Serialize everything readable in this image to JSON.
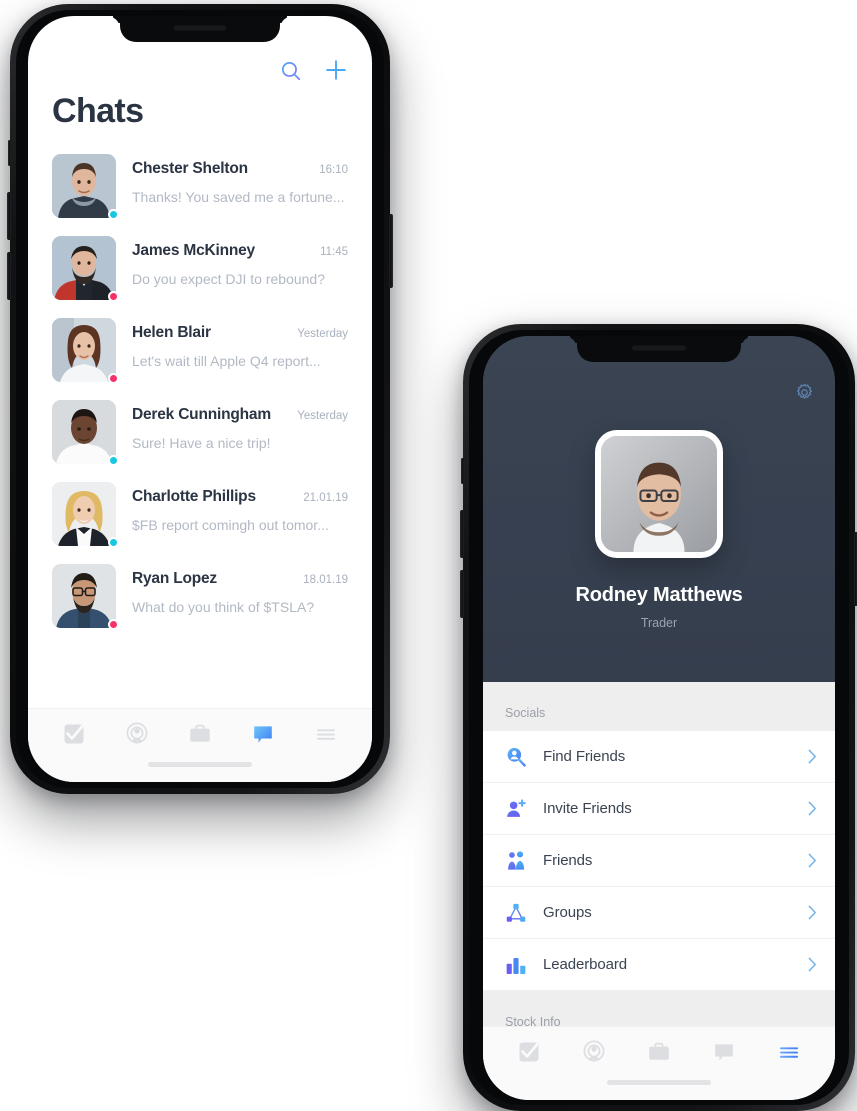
{
  "left_phone": {
    "screen_name": "chats-screen",
    "topbar": {
      "search_icon": "search-icon",
      "add_icon": "plus-icon"
    },
    "title": "Chats",
    "chats": [
      {
        "name": "Chester Shelton",
        "time": "16:10",
        "preview": "Thanks! You saved me a fortune...",
        "status": "online",
        "avatar": "avatar-chester"
      },
      {
        "name": "James McKinney",
        "time": "11:45",
        "preview": "Do you expect DJI to rebound?",
        "status": "offline",
        "avatar": "avatar-james"
      },
      {
        "name": "Helen Blair",
        "time": "Yesterday",
        "preview": "Let's wait till Apple Q4 report...",
        "status": "offline",
        "avatar": "avatar-helen"
      },
      {
        "name": "Derek Cunningham",
        "time": "Yesterday",
        "preview": "Sure! Have a nice trip!",
        "status": "online",
        "avatar": "avatar-derek"
      },
      {
        "name": "Charlotte Phillips",
        "time": "21.01.19",
        "preview": "$FB report comingh out tomor...",
        "status": "online",
        "avatar": "avatar-charlotte"
      },
      {
        "name": "Ryan Lopez",
        "time": "18.01.19",
        "preview": "What do you think of $TSLA?",
        "status": "offline",
        "avatar": "avatar-ryan"
      }
    ],
    "tabbar": {
      "active": "chat",
      "items": [
        {
          "key": "tasks",
          "icon": "checkbox-check-icon"
        },
        {
          "key": "radar",
          "icon": "radar-person-icon"
        },
        {
          "key": "portfolio",
          "icon": "briefcase-icon"
        },
        {
          "key": "chat",
          "icon": "chat-bubble-icon"
        },
        {
          "key": "more",
          "icon": "hamburger-menu-icon"
        }
      ]
    }
  },
  "right_phone": {
    "screen_name": "profile-screen",
    "settings_icon": "gear-icon",
    "profile": {
      "name": "Rodney Matthews",
      "role": "Trader",
      "photo": "avatar-rodney"
    },
    "sections": [
      {
        "title": "Socials",
        "items": [
          {
            "label": "Find Friends",
            "icon": "find-friends-icon"
          },
          {
            "label": "Invite Friends",
            "icon": "invite-friends-icon"
          },
          {
            "label": "Friends",
            "icon": "friends-icon"
          },
          {
            "label": "Groups",
            "icon": "groups-icon"
          },
          {
            "label": "Leaderboard",
            "icon": "leaderboard-icon"
          }
        ]
      },
      {
        "title": "Stock Info",
        "items": []
      }
    ],
    "tabbar": {
      "active": "more",
      "items": [
        {
          "key": "tasks",
          "icon": "checkbox-check-icon"
        },
        {
          "key": "radar",
          "icon": "radar-person-icon"
        },
        {
          "key": "portfolio",
          "icon": "briefcase-icon"
        },
        {
          "key": "chat",
          "icon": "chat-bubble-icon"
        },
        {
          "key": "more",
          "icon": "hamburger-menu-icon"
        }
      ]
    }
  },
  "colors": {
    "accent_blue": "#3d9ff5",
    "accent_purple": "#7b6cf6",
    "status_online": "#19c8e0",
    "status_offline": "#f5336a",
    "dark_header": "#394351",
    "title_text": "#2b3443",
    "muted_text": "#b2b9c4"
  }
}
